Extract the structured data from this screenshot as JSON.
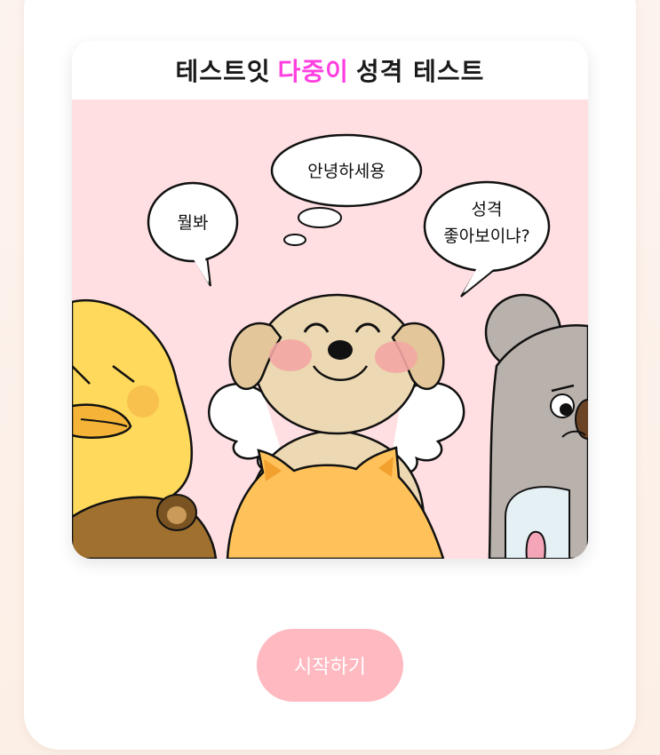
{
  "title": {
    "prefix": "테스트잇",
    "highlight": "다중이",
    "suffix": "성격 테스트"
  },
  "comic": {
    "bubbles": {
      "left": "뭘봐",
      "center": "안녕하세용",
      "right_line1": "성격",
      "right_line2": "좋아보이냐?"
    }
  },
  "start_button": {
    "label": "시작하기"
  },
  "colors": {
    "highlight": "#ff3fe0",
    "button": "#ffb9c1",
    "comic_bg": "#ffdfe2"
  }
}
